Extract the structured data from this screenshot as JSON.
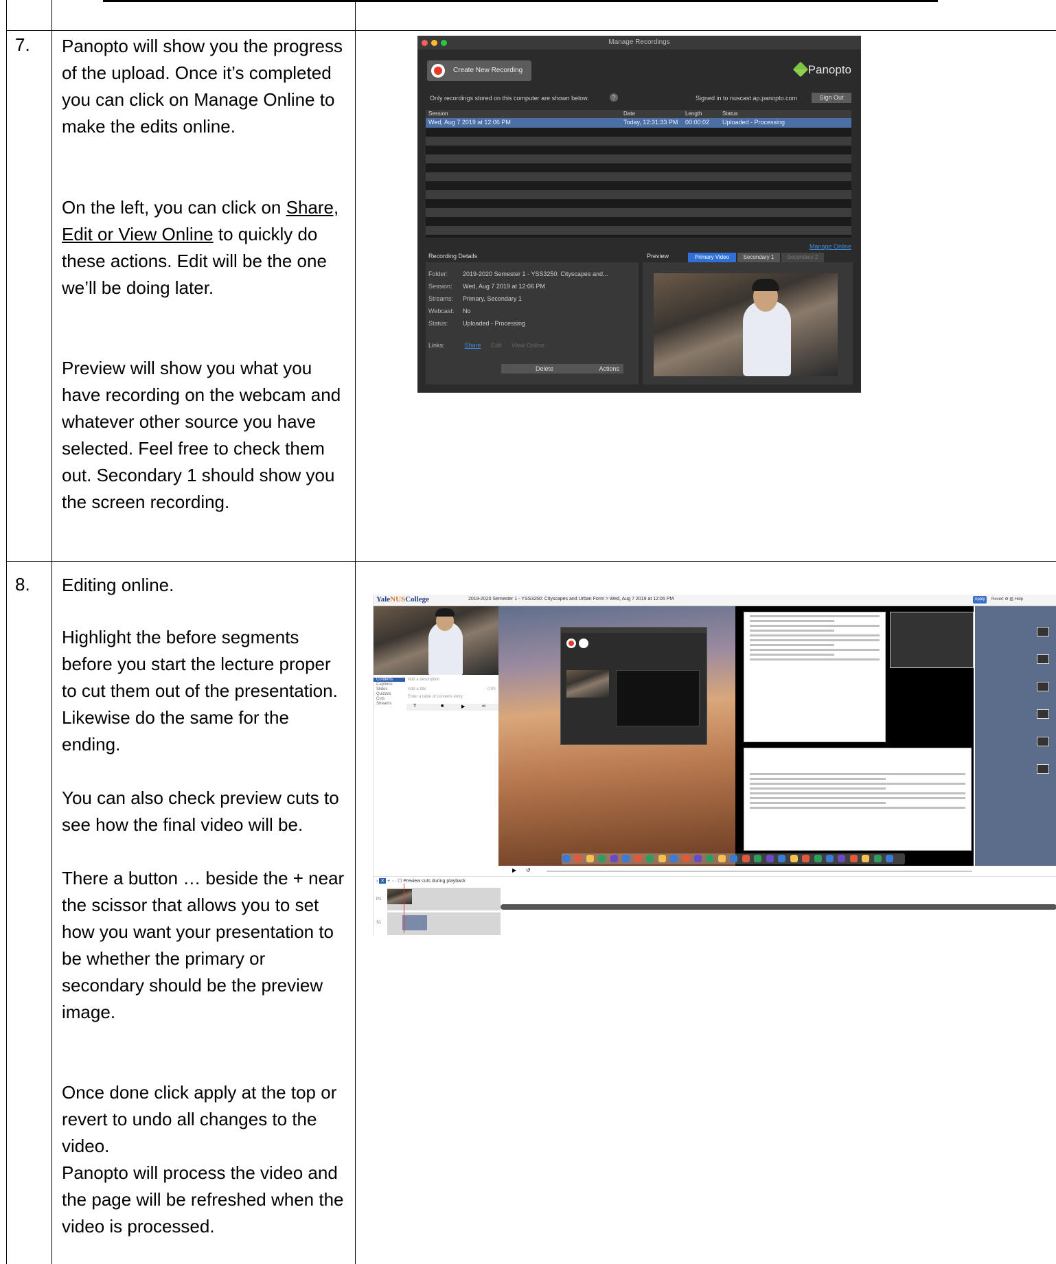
{
  "rows": [
    {
      "number": "7.",
      "paragraphs": [
        "Panopto will show you the progress of the upload. Once it’s completed you can click on Manage Online to make the edits online.",
        "Preview will show you what you have recording on the webcam and whatever other source you have selected. Feel free to check them out. Secondary 1 should show you the screen recording."
      ],
      "para2": {
        "before": "On the left, you can click on ",
        "link": "Share, Edit or View Online",
        "after": " to quickly do these actions. Edit will be the one we’ll be doing later."
      }
    },
    {
      "number": "8.",
      "paragraphs": [
        "Editing online.",
        "Highlight the before segments before you start the lecture proper to cut them out of the presentation. Likewise do the same for the ending.",
        "You can also check preview cuts to see how the final video will be.",
        "There a button … beside the + near the scissor that allows you to set how you want your presentation to be whether the primary or secondary should be the preview image.",
        "Once done click apply at the top or revert to undo all changes to the video.",
        "Panopto will process the video and the page will be refreshed when the video is processed."
      ]
    }
  ],
  "manage_recordings": {
    "window_title": "Manage Recordings",
    "create_button": "Create New Recording",
    "brand": "Panopto",
    "info_text": "Only recordings stored on this computer are shown below.",
    "help": "?",
    "signed_in": "Signed in to nuscast.ap.panopto.com",
    "sign_out": "Sign Out",
    "columns": [
      "Session",
      "Date",
      "Length",
      "Status"
    ],
    "row": [
      "Wed, Aug 7 2019 at 12:06 PM",
      "Today, 12:31:33 PM",
      "00:00:02",
      "Uploaded - Processing"
    ],
    "manage_online": "Manage Online",
    "details_title": "Recording Details",
    "details": [
      {
        "key": "Folder:",
        "value": "2019-2020 Semester 1 - YSS3250: Cityscapes and..."
      },
      {
        "key": "Session:",
        "value": "Wed, Aug 7 2019 at 12:06 PM"
      },
      {
        "key": "Streams:",
        "value": "Primary, Secondary 1"
      },
      {
        "key": "Webcast:",
        "value": "No"
      },
      {
        "key": "Status:",
        "value": "Uploaded - Processing"
      }
    ],
    "links_label": "Links:",
    "links": [
      "Share",
      "Edit",
      "View Online"
    ],
    "delete": "Delete",
    "actions": "Actions",
    "preview_label": "Preview",
    "tabs": [
      "Primary Video",
      "Secondary 1",
      "Secondary 2"
    ]
  },
  "editor": {
    "logo_a": "Yale",
    "logo_b": "NUS",
    "logo_c": "College",
    "breadcrumb": "2019-2020 Semester 1 - YSS3250: Cityscapes and Urban Form  >  Wed, Aug 7 2019 at 12:06 PM",
    "apply": "Apply",
    "revert": "Revert",
    "help": "Help",
    "nav": [
      "Contents",
      "Captions",
      "Slides",
      "Quizzes",
      "Cuts",
      "Streams"
    ],
    "add_description": "Add a description",
    "add_title": "Add a title",
    "toc_placeholder": "Enter a table of contents entry",
    "time_zero": "0:00",
    "preview_cuts": "Preview cuts during playback",
    "track_p1": "P1",
    "track_s1": "S1"
  }
}
